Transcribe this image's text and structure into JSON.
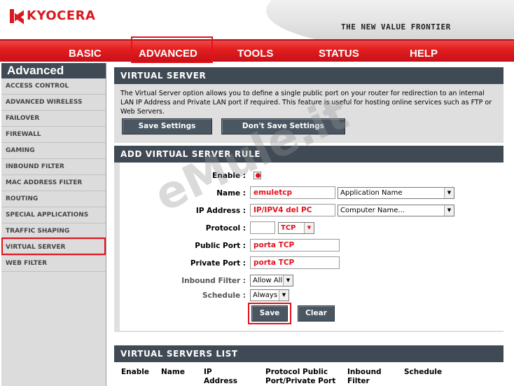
{
  "header": {
    "logo_text": "KYOCERA",
    "tagline": "THE NEW VALUE FRONTIER"
  },
  "topnav": {
    "tabs": [
      {
        "label": "BASIC"
      },
      {
        "label": "ADVANCED"
      },
      {
        "label": "TOOLS"
      },
      {
        "label": "STATUS"
      },
      {
        "label": "HELP"
      }
    ],
    "selected": "ADVANCED"
  },
  "sidebar": {
    "title": "Advanced",
    "items": [
      {
        "label": "ACCESS CONTROL"
      },
      {
        "label": "ADVANCED WIRELESS"
      },
      {
        "label": "FAILOVER"
      },
      {
        "label": "FIREWALL"
      },
      {
        "label": "GAMING"
      },
      {
        "label": "INBOUND FILTER"
      },
      {
        "label": "MAC ADDRESS FILTER"
      },
      {
        "label": "ROUTING"
      },
      {
        "label": "SPECIAL APPLICATIONS"
      },
      {
        "label": "TRAFFIC SHAPING"
      },
      {
        "label": "VIRTUAL SERVER"
      },
      {
        "label": "WEB FILTER"
      }
    ],
    "selected": "VIRTUAL SERVER"
  },
  "virtual_server": {
    "title": "VIRTUAL SERVER",
    "description": "The Virtual Server option allows you to define a single public port on your router for redirection to an internal LAN IP Address and Private LAN port if required. This feature is useful for hosting online services such as FTP or Web Servers.",
    "save_label": "Save Settings",
    "dont_save_label": "Don't Save Settings"
  },
  "add_rule": {
    "title": "ADD VIRTUAL SERVER RULE",
    "enable_label": "Enable :",
    "name_label": "Name :",
    "name_value": "emuletcp",
    "name_select": "Application Name",
    "ip_label": "IP Address :",
    "ip_value": "IP/IPV4 del PC",
    "ip_select": "Computer Name...",
    "protocol_label": "Protocol :",
    "protocol_value": "",
    "protocol_select": "TCP",
    "public_port_label": "Public Port :",
    "public_port_value": "porta TCP",
    "private_port_label": "Private Port :",
    "private_port_value": "porta TCP",
    "inbound_filter_label": "Inbound Filter :",
    "inbound_filter_value": "Allow All",
    "schedule_label": "Schedule :",
    "schedule_value": "Always",
    "save_label": "Save",
    "clear_label": "Clear"
  },
  "servers_list": {
    "title": "VIRTUAL SERVERS LIST",
    "columns": [
      {
        "line1": "Enable",
        "line2": ""
      },
      {
        "line1": "Name",
        "line2": ""
      },
      {
        "line1": "IP",
        "line2": "Address"
      },
      {
        "line1": "Protocol Public",
        "line2": "Port/Private Port"
      },
      {
        "line1": "Inbound",
        "line2": "Filter"
      },
      {
        "line1": "Schedule",
        "line2": ""
      }
    ]
  },
  "watermark": "eMule.it",
  "colors": {
    "accent_red": "#e3121b",
    "header_bar": "#404a55",
    "panel_bg": "#dfdfdf"
  }
}
